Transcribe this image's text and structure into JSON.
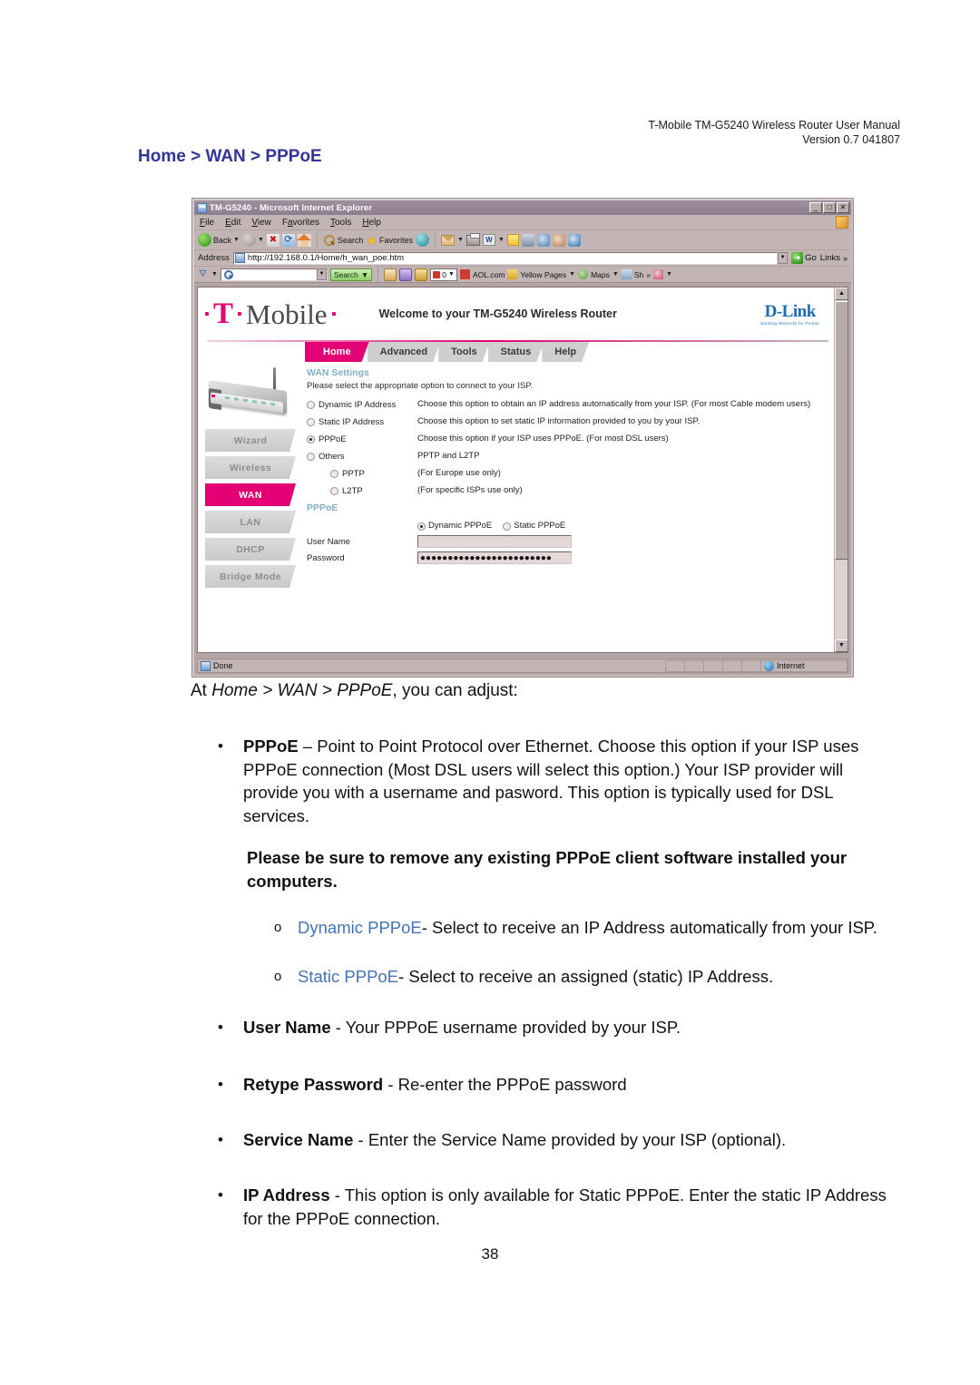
{
  "document": {
    "header_line1": "T-Mobile TM-G5240 Wireless Router User Manual",
    "header_line2": "Version 0.7 041807",
    "breadcrumb": "Home > WAN > PPPoE",
    "intro_prefix": "At ",
    "intro_italic": "Home > WAN > PPPoE",
    "intro_suffix": ", you can adjust:",
    "page_number": "38",
    "bullet_marker": "•",
    "sub_marker": "o",
    "bullets": [
      {
        "term": "PPPoE",
        "text": " – Point to Point Protocol over Ethernet. Choose this option if your ISP uses PPPoE connection (Most DSL users will select this option.) Your ISP provider will provide you with a username and pasword. This option is typically used for DSL services."
      },
      {
        "term": "User Name",
        "text": " - Your PPPoE username provided by your ISP."
      },
      {
        "term": "Retype Password",
        "text": " - Re-enter the PPPoE password"
      },
      {
        "term": "Service Name",
        "text": " - Enter the Service Name provided by your ISP (optional)."
      },
      {
        "term": "IP Address",
        "text": " - This option is only available for Static PPPoE. Enter the static IP Address for the PPPoE connection."
      }
    ],
    "warning": "Please be sure to remove any existing PPPoE client software installed your computers.",
    "sub_bullets": [
      {
        "link": "Dynamic PPPoE",
        "text": "- Select to receive an IP Address automatically from your ISP."
      },
      {
        "link": "Static PPPoE",
        "text": "- Select to receive an assigned (static) IP Address."
      }
    ],
    "link_color": "#4472b8",
    "heading_color": "#333399"
  },
  "browser": {
    "title": "TM-G5240 - Microsoft Internet Explorer",
    "window_buttons": [
      "_",
      "□",
      "✕"
    ],
    "menu": [
      {
        "label": "File",
        "accel": "F"
      },
      {
        "label": "Edit",
        "accel": "E"
      },
      {
        "label": "View",
        "accel": "V"
      },
      {
        "label": "Favorites",
        "accel": "a"
      },
      {
        "label": "Tools",
        "accel": "T"
      },
      {
        "label": "Help",
        "accel": "H"
      }
    ],
    "toolbar": {
      "back_label": "Back",
      "search_label": "Search",
      "favorites_label": "Favorites"
    },
    "address": {
      "label": "Address",
      "url": "http://192.168.0.1/Home/h_wan_poe.htm",
      "go_label": "Go",
      "links_label": "Links",
      "links_chevron": "»"
    },
    "aol_toolbar": {
      "search_placeholder": "",
      "search_button": "Search",
      "items": [
        "AOL.com",
        "Yellow Pages",
        "Maps",
        "Sh"
      ],
      "counter": "0",
      "overflow": "»"
    },
    "statusbar": {
      "status": "Done",
      "zone": "Internet"
    }
  },
  "router_ui": {
    "brand": {
      "tmobile_t": "T",
      "tmobile_word": "Mobile",
      "welcome": "Welcome to your TM-G5240 Wireless Router",
      "dlink_name": "D-Link",
      "dlink_tagline": "Building Networks for People",
      "accent": "#e20074"
    },
    "tabs": [
      {
        "label": "Home",
        "active": true
      },
      {
        "label": "Advanced",
        "active": false
      },
      {
        "label": "Tools",
        "active": false
      },
      {
        "label": "Status",
        "active": false
      },
      {
        "label": "Help",
        "active": false
      }
    ],
    "sidebar": [
      {
        "label": "Wizard",
        "active": false
      },
      {
        "label": "Wireless",
        "active": false
      },
      {
        "label": "WAN",
        "active": true
      },
      {
        "label": "LAN",
        "active": false
      },
      {
        "label": "DHCP",
        "active": false
      },
      {
        "label": "Bridge Mode",
        "active": false
      }
    ],
    "wan_settings": {
      "title": "WAN Settings",
      "description": "Please select the appropriate option to connect to your ISP.",
      "options": [
        {
          "label": "Dynamic IP Address",
          "selected": false,
          "indent": false,
          "desc": "Choose this option to obtain an IP address automatically from your ISP. (For most Cable modem users)"
        },
        {
          "label": "Static IP Address",
          "selected": false,
          "indent": false,
          "desc": "Choose this option to set static IP information provided to you by your ISP."
        },
        {
          "label": "PPPoE",
          "selected": true,
          "indent": false,
          "desc": "Choose this option if your ISP uses PPPoE. (For most DSL users)"
        },
        {
          "label": "Others",
          "selected": false,
          "indent": false,
          "desc": "PPTP and L2TP"
        },
        {
          "label": "PPTP",
          "selected": false,
          "indent": true,
          "desc": "(For Europe use only)"
        },
        {
          "label": "L2TP",
          "selected": false,
          "indent": true,
          "desc": "(For specific ISPs use only)"
        }
      ]
    },
    "pppoe": {
      "title": "PPPoE",
      "mode_options": [
        {
          "label": "Dynamic PPPoE",
          "selected": true
        },
        {
          "label": "Static PPPoE",
          "selected": false
        }
      ],
      "fields": [
        {
          "label": "User Name",
          "value": ""
        },
        {
          "label": "Password",
          "value": "●●●●●●●●●●●●●●●●●●●●●●●●"
        }
      ]
    }
  }
}
